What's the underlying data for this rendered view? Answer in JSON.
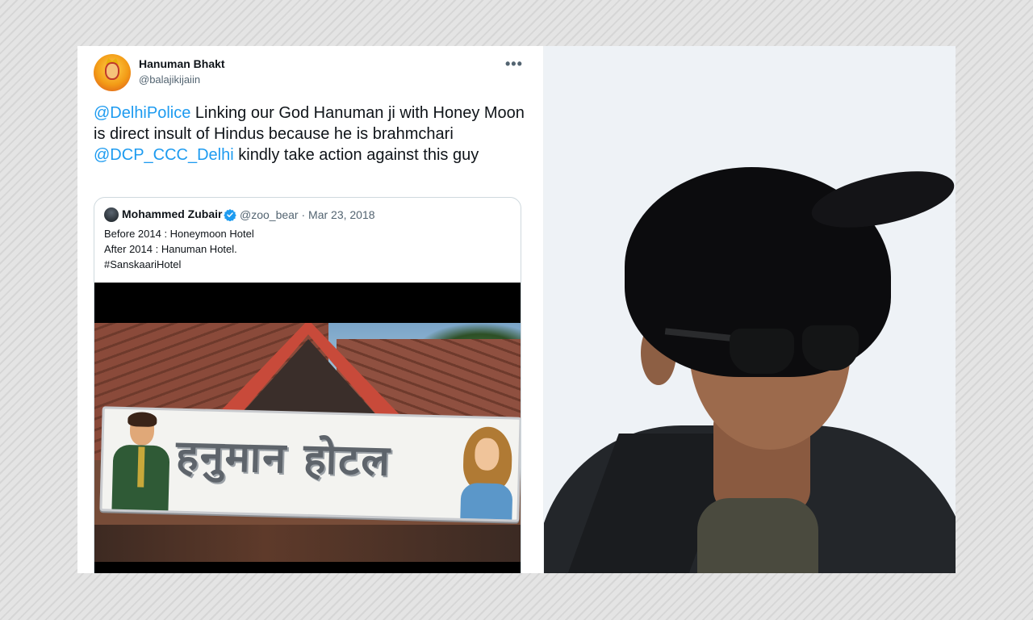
{
  "tweet": {
    "author_name": "Hanuman Bhakt",
    "author_handle": "@balajikijaiin",
    "more_label": "•••",
    "text_parts": {
      "mention1": "@DelhiPolice",
      "part1": " Linking our God Hanuman ji with Honey Moon is direct insult of Hindus  because he is brahmchari ",
      "mention2": "@DCP_CCC_Delhi",
      "part2": " kindly take action against this guy"
    }
  },
  "quoted_tweet": {
    "author_name": "Mohammed Zubair",
    "handle_date": "@zoo_bear · Mar 23, 2018",
    "lines": [
      "Before 2014 : Honeymoon Hotel",
      "After 2014 : Hanuman Hotel.",
      "#SanskaariHotel"
    ],
    "sign_text": "हनुमान होटल"
  },
  "colors": {
    "mention": "#1d9bf0",
    "verified": "#1d9bf0",
    "text": "#0f1419",
    "muted": "#536471"
  },
  "icons": {
    "more": "more-horizontal-icon",
    "verified": "verified-badge-icon"
  }
}
